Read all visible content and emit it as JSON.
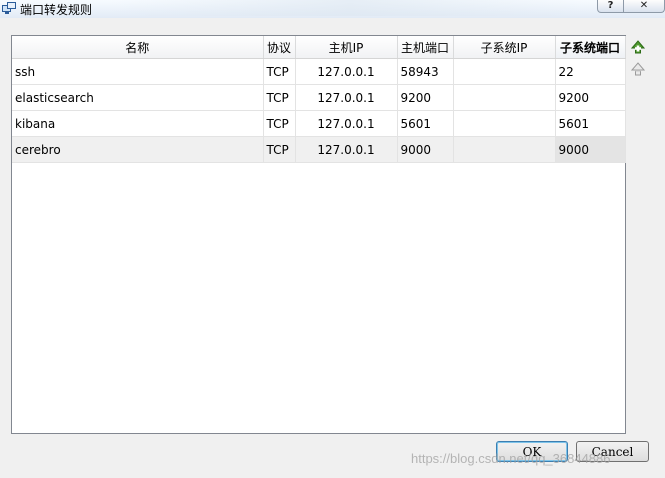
{
  "window": {
    "title": "端口转发规则",
    "help_button": "?",
    "close_button": "✕"
  },
  "table": {
    "columns": [
      "名称",
      "协议",
      "主机IP",
      "主机端口",
      "子系统IP",
      "子系统端口"
    ],
    "sorted_column": "子系统端口",
    "rows": [
      {
        "name": "ssh",
        "protocol": "TCP",
        "host_ip": "127.0.0.1",
        "host_port": "58943",
        "guest_ip": "",
        "guest_port": "22"
      },
      {
        "name": "elasticsearch",
        "protocol": "TCP",
        "host_ip": "127.0.0.1",
        "host_port": "9200",
        "guest_ip": "",
        "guest_port": "9200"
      },
      {
        "name": "kibana",
        "protocol": "TCP",
        "host_ip": "127.0.0.1",
        "host_port": "5601",
        "guest_ip": "",
        "guest_port": "5601"
      },
      {
        "name": "cerebro",
        "protocol": "TCP",
        "host_ip": "127.0.0.1",
        "host_port": "9000",
        "guest_ip": "",
        "guest_port": "9000"
      }
    ],
    "selected_row": 3
  },
  "tools": {
    "add_icon": "add-rule-icon",
    "remove_icon": "remove-rule-icon"
  },
  "buttons": {
    "ok": "OK",
    "cancel": "Cancel"
  },
  "watermark": "https://blog.csdn.net/qq_36844886"
}
